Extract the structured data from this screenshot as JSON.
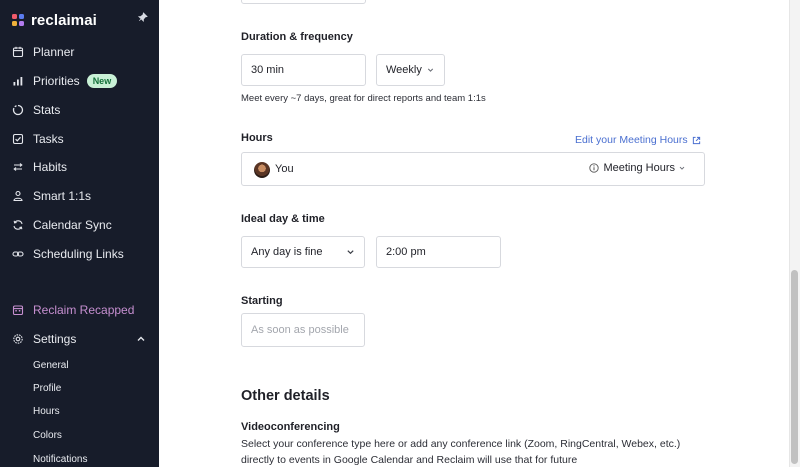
{
  "app": {
    "logo_text": "reclaimai"
  },
  "sidebar": {
    "items": [
      {
        "label": "Planner",
        "icon": "calendar-icon"
      },
      {
        "label": "Priorities",
        "icon": "bar-chart-icon",
        "badge": "New"
      },
      {
        "label": "Stats",
        "icon": "stats-icon"
      },
      {
        "label": "Tasks",
        "icon": "checkbox-icon"
      },
      {
        "label": "Habits",
        "icon": "repeat-icon"
      },
      {
        "label": "Smart 1:1s",
        "icon": "people-icon"
      },
      {
        "label": "Calendar Sync",
        "icon": "sync-icon"
      },
      {
        "label": "Scheduling Links",
        "icon": "link-icon"
      }
    ],
    "recapped": "Reclaim Recapped",
    "settings": {
      "label": "Settings",
      "sub_items": [
        "General",
        "Profile",
        "Hours",
        "Colors",
        "Notifications"
      ]
    }
  },
  "form": {
    "duration_label": "Duration & frequency",
    "duration_value": "30 min",
    "frequency_value": "Weekly",
    "frequency_hint": "Meet every ~7 days, great for direct reports and team 1:1s",
    "hours_label": "Hours",
    "edit_hours_link": "Edit your Meeting Hours",
    "hours_person": "You",
    "hours_type": "Meeting Hours",
    "ideal_label": "Ideal day & time",
    "day_value": "Any day is fine",
    "time_value": "2:00 pm",
    "starting_label": "Starting",
    "starting_placeholder": "As soon as possible"
  },
  "other_details": {
    "title": "Other details",
    "video_label": "Videoconferencing",
    "video_desc": "Select your conference type here or add any conference link (Zoom, RingCentral, Webex, etc.) directly to events in Google Calendar and Reclaim will use that for future"
  },
  "colors": {
    "sidebar_bg": "#171c2a",
    "accent_link": "#4a6fd0",
    "badge_bg": "#c9f1d6",
    "recapped": "#c68fd0"
  }
}
